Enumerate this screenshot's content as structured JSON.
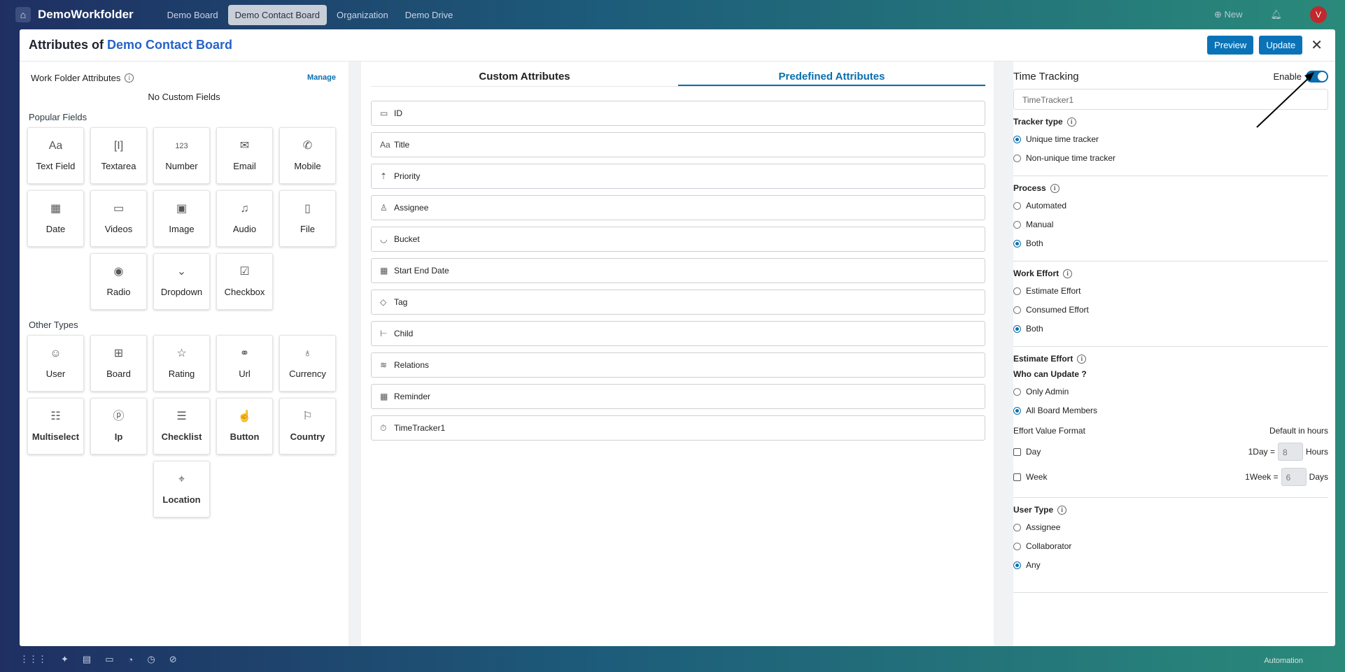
{
  "topbar": {
    "brand": "DemoWorkfolder",
    "tabs": [
      {
        "label": "Demo Board",
        "active": false
      },
      {
        "label": "Demo Contact Board",
        "active": true
      },
      {
        "label": "Organization",
        "active": false
      },
      {
        "label": "Demo Drive",
        "active": false
      }
    ],
    "new_label": "New",
    "avatar_letter": "V"
  },
  "bottombar": {
    "automation_label": "Automation"
  },
  "modal": {
    "title_prefix": "Attributes of",
    "title_board": "Demo Contact Board",
    "preview_label": "Preview",
    "update_label": "Update"
  },
  "left": {
    "work_folder_attributes": "Work Folder Attributes",
    "manage_label": "Manage",
    "no_custom_fields": "No Custom Fields",
    "popular_fields_label": "Popular Fields",
    "popular_fields": [
      {
        "label": "Text Field",
        "icon": "text-field-icon"
      },
      {
        "label": "Textarea",
        "icon": "textarea-icon"
      },
      {
        "label": "Number",
        "icon": "number-icon"
      },
      {
        "label": "Email",
        "icon": "email-icon"
      },
      {
        "label": "Mobile",
        "icon": "phone-icon"
      },
      {
        "label": "Date",
        "icon": "calendar-icon"
      },
      {
        "label": "Videos",
        "icon": "video-icon"
      },
      {
        "label": "Image",
        "icon": "image-icon"
      },
      {
        "label": "Audio",
        "icon": "audio-icon"
      },
      {
        "label": "File",
        "icon": "file-icon"
      },
      {
        "label": "Radio",
        "icon": "radio-icon"
      },
      {
        "label": "Dropdown",
        "icon": "dropdown-icon"
      },
      {
        "label": "Checkbox",
        "icon": "checkbox-icon"
      }
    ],
    "other_types_label": "Other Types",
    "other_types": [
      {
        "label": "User",
        "icon": "user-icon"
      },
      {
        "label": "Board",
        "icon": "board-icon"
      },
      {
        "label": "Rating",
        "icon": "star-icon"
      },
      {
        "label": "Url",
        "icon": "link-icon"
      },
      {
        "label": "Currency",
        "icon": "money-bag-icon"
      },
      {
        "label": "Multiselect",
        "icon": "multiselect-icon"
      },
      {
        "label": "Ip",
        "icon": "ip-icon"
      },
      {
        "label": "Checklist",
        "icon": "checklist-icon"
      },
      {
        "label": "Button",
        "icon": "pointer-hand-icon"
      },
      {
        "label": "Country",
        "icon": "flag-icon"
      },
      {
        "label": "Location",
        "icon": "location-pin-icon"
      }
    ]
  },
  "middle": {
    "tab_custom": "Custom Attributes",
    "tab_predefined": "Predefined Attributes",
    "attributes": [
      {
        "label": "ID",
        "icon": "id-icon"
      },
      {
        "label": "Title",
        "icon": "text-field-icon"
      },
      {
        "label": "Priority",
        "icon": "priority-icon"
      },
      {
        "label": "Assignee",
        "icon": "add-user-icon"
      },
      {
        "label": "Bucket",
        "icon": "bucket-icon"
      },
      {
        "label": "Start End Date",
        "icon": "calendar-icon"
      },
      {
        "label": "Tag",
        "icon": "tag-icon"
      },
      {
        "label": "Child",
        "icon": "hierarchy-icon"
      },
      {
        "label": "Relations",
        "icon": "relations-icon"
      },
      {
        "label": "Reminder",
        "icon": "calendar-icon"
      },
      {
        "label": "TimeTracker1",
        "icon": "stopwatch-icon"
      }
    ]
  },
  "right": {
    "time_tracking_label": "Time Tracking",
    "enable_label": "Enable",
    "enabled": true,
    "tracker_name": "TimeTracker1",
    "tracker_type_label": "Tracker type",
    "tracker_type_options": [
      {
        "label": "Unique time tracker",
        "checked": true
      },
      {
        "label": "Non-unique time tracker",
        "checked": false
      }
    ],
    "process_label": "Process",
    "process_options": [
      {
        "label": "Automated",
        "checked": false
      },
      {
        "label": "Manual",
        "checked": false
      },
      {
        "label": "Both",
        "checked": true
      }
    ],
    "work_effort_label": "Work Effort",
    "work_effort_options": [
      {
        "label": "Estimate Effort",
        "checked": false
      },
      {
        "label": "Consumed Effort",
        "checked": false
      },
      {
        "label": "Both",
        "checked": true
      }
    ],
    "estimate_effort_label": "Estimate Effort",
    "who_can_update_label": "Who can Update ?",
    "who_can_update_options": [
      {
        "label": "Only Admin",
        "checked": false
      },
      {
        "label": "All Board Members",
        "checked": true
      }
    ],
    "effort_value_format_label": "Effort Value Format",
    "default_in_hours_label": "Default in hours",
    "day_label": "Day",
    "day_eq_label": "1Day =",
    "day_value": "8",
    "day_unit": "Hours",
    "week_label": "Week",
    "week_eq_label": "1Week =",
    "week_value": "6",
    "week_unit": "Days",
    "user_type_label": "User Type",
    "user_type_options": [
      {
        "label": "Assignee",
        "checked": false
      },
      {
        "label": "Collaborator",
        "checked": false
      },
      {
        "label": "Any",
        "checked": true
      }
    ]
  },
  "colors": {
    "accent": "#0a6fae",
    "brand_title": "#2563c9",
    "avatar": "#c0282d"
  }
}
